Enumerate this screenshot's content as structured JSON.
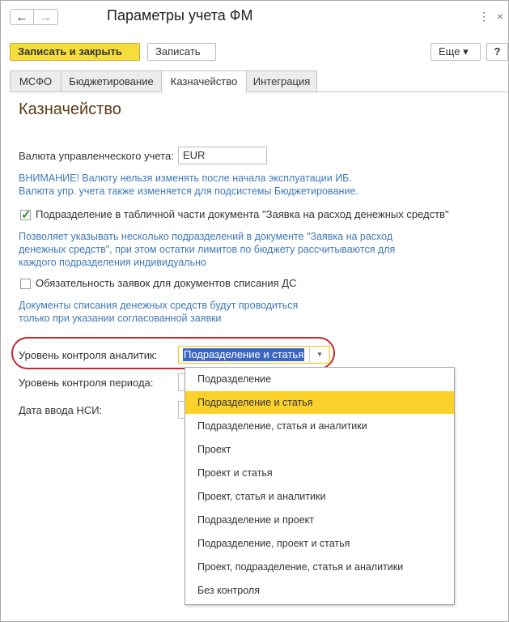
{
  "window": {
    "title": "Параметры учета ФМ",
    "nav_back": "←",
    "nav_forward": "→",
    "menu_glyph": "⋮",
    "close_glyph": "×"
  },
  "toolbar": {
    "save_close_label": "Записать и закрыть",
    "save_label": "Записать",
    "more_label": "Еще ▾",
    "help_label": "?"
  },
  "tabs": [
    {
      "label": "МСФО",
      "active": false
    },
    {
      "label": "Бюджетирование",
      "active": false
    },
    {
      "label": "Казначейство",
      "active": true
    },
    {
      "label": "Интеграция",
      "active": false
    }
  ],
  "section": {
    "heading": "Казначейство",
    "currency_label": "Валюта управленческого учета:",
    "currency_value": "EUR",
    "currency_hint_1": "ВНИМАНИЕ! Валюту нельзя изменять после начала эксплуатации ИБ.",
    "currency_hint_2": "Валюта упр. учета также изменяется для подсистемы Бюджетирование.",
    "dept_check_label": "Подразделение в табличной части документа \"Заявка на расход денежных средств\"",
    "dept_check_checked": true,
    "dept_hint_1": "Позволяет указывать несколько подразделений в документе \"Заявка на расход",
    "dept_hint_2": "денежных средств\", при этом остатки лимитов по бюджету рассчитываются для",
    "dept_hint_3": "каждого подразделения индивидуально",
    "req_check_label": "Обязательность заявок для документов списания ДС",
    "req_check_checked": false,
    "req_hint_1": "Документы списания денежных средств будут проводиться",
    "req_hint_2": "только при указании согласованной заявки",
    "analytics_label": "Уровень контроля аналитик:",
    "analytics_value": "Подразделение и статья",
    "period_label": "Уровень контроля периода:",
    "nsi_label": "Дата ввода НСИ:"
  },
  "dropdown": {
    "options": [
      "Подразделение",
      "Подразделение и статья",
      "Подразделение, статья и аналитики",
      "Проект",
      "Проект и статья",
      "Проект, статья и аналитики",
      "Подразделение и проект",
      "Подразделение, проект и статья",
      "Проект, подразделение, статья и аналитики",
      "Без контроля"
    ],
    "selected_index": 1
  },
  "colors": {
    "accent_button": "#f5dd3b",
    "selected_option": "#fbd12b",
    "hint_text": "#3e78b8",
    "heading_text": "#5a3d15",
    "highlight_ring": "#c0282c"
  }
}
